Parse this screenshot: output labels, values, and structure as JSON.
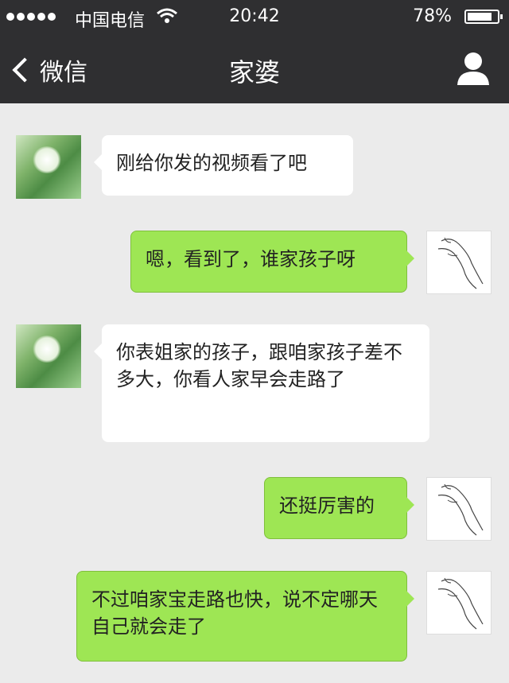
{
  "status_bar": {
    "carrier": "中国电信",
    "time": "20:42",
    "battery": "78%",
    "battery_level": 0.78
  },
  "nav": {
    "back_label": "微信",
    "title": "家婆",
    "profile_icon": "person-icon",
    "bar_color": "#2f2f31"
  },
  "colors": {
    "background": "#ebebeb",
    "sent_bubble": "#9ee654",
    "received_bubble": "#ffffff"
  },
  "messages": [
    {
      "from": "friend",
      "text": "刚给你发的视频看了吧"
    },
    {
      "from": "self",
      "text": "嗯，看到了，谁家孩子呀"
    },
    {
      "from": "friend",
      "text": "你表姐家的孩子，跟咱家孩子差不多大，你看人家早会走路了"
    },
    {
      "from": "self",
      "text": "还挺厉害的"
    },
    {
      "from": "self",
      "text": "不过咱家宝走路也快，说不定哪天自己就会走了"
    }
  ]
}
